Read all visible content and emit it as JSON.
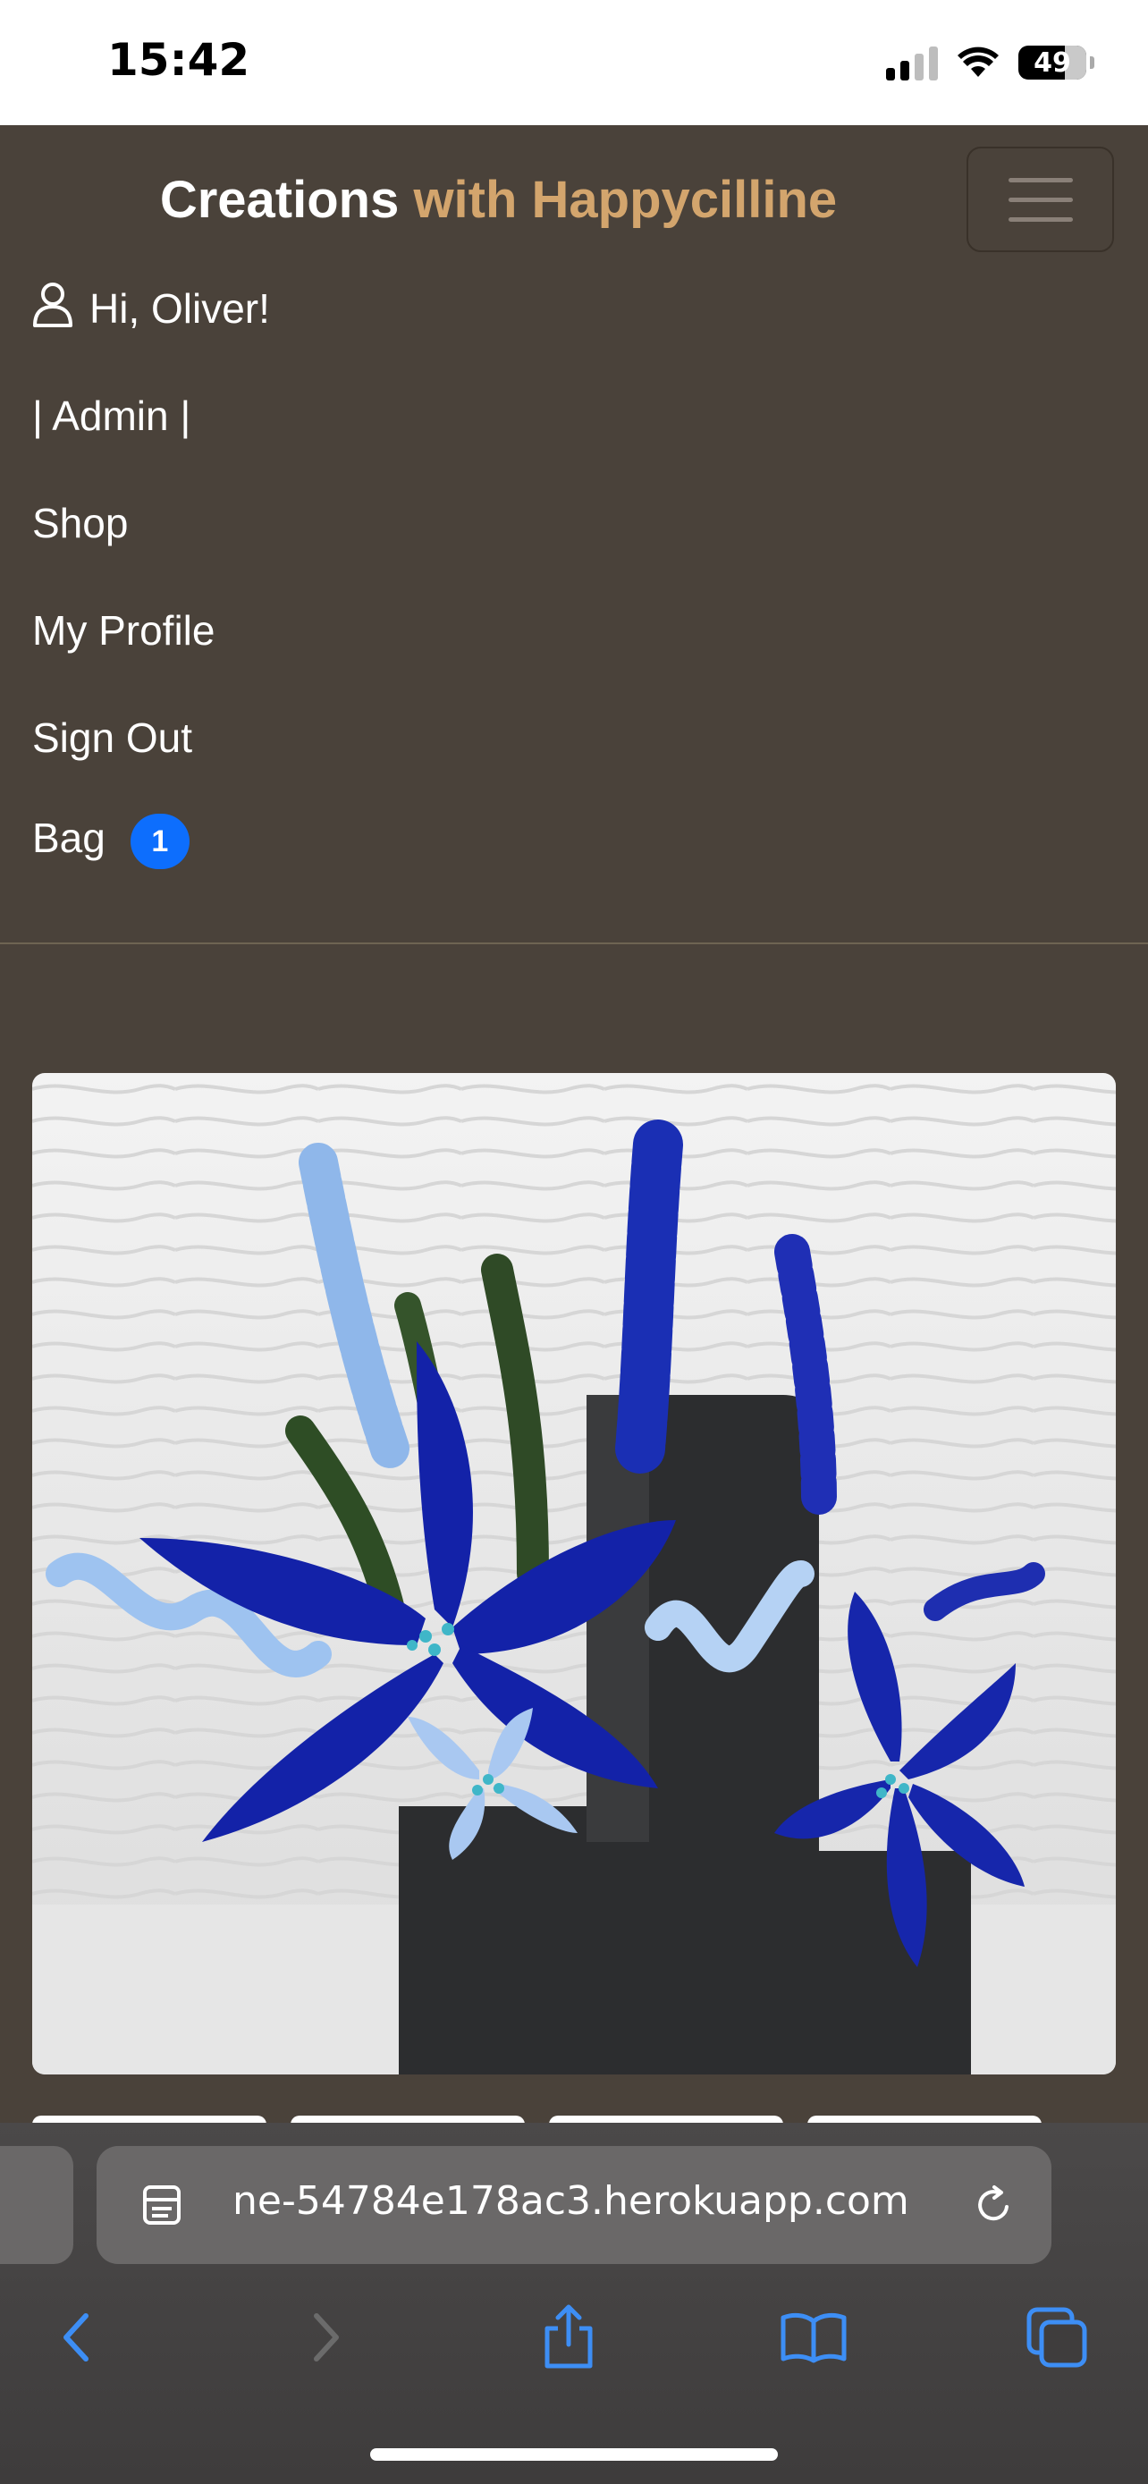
{
  "status_bar": {
    "time": "15:42",
    "battery_level": "49",
    "signal_bars_active": 2,
    "signal_bars_total": 4,
    "icons": [
      "signal-icon",
      "wifi-icon",
      "battery-icon"
    ]
  },
  "header": {
    "brand_primary": "Creations",
    "brand_accent": " with Happycilline",
    "accent_color": "#d3a56d",
    "toggler_icon": "hamburger-menu-icon"
  },
  "nav": {
    "greeting": "Hi, Oliver!",
    "user_icon": "user-icon",
    "admin": "| Admin |",
    "shop": "Shop",
    "my_profile": "My Profile",
    "sign_out": "Sign Out",
    "bag": "Bag",
    "bag_count": "1",
    "badge_color": "#0d6efd"
  },
  "product": {
    "image_icon": "flower-arrangement-image",
    "thumbnail_count": 4
  },
  "browser": {
    "url": "ne-54784e178ac3.herokuapp.com",
    "icons": [
      "reader-icon",
      "reload-icon",
      "back-icon",
      "forward-icon",
      "share-icon",
      "bookmarks-icon",
      "tabs-icon"
    ]
  }
}
